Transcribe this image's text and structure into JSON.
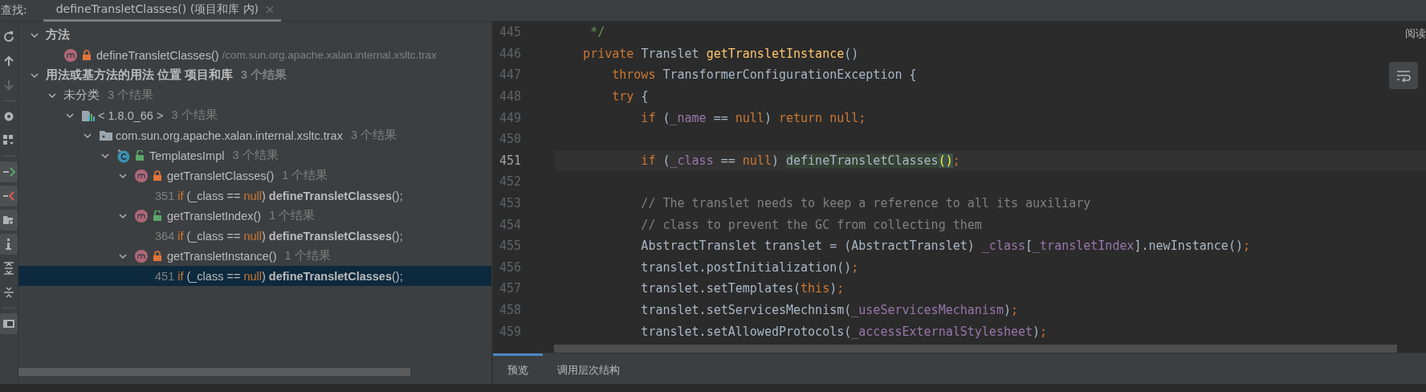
{
  "find_bar": {
    "label": "查找:",
    "tab": {
      "title": "defineTransletClasses() (项目和库 内)",
      "selected": true
    }
  },
  "toolbar": [
    {
      "kind": "refresh",
      "disabled": false,
      "on": false
    },
    {
      "kind": "up",
      "disabled": false,
      "on": false
    },
    {
      "kind": "down",
      "disabled": true,
      "on": false
    },
    {
      "kind": "settings",
      "disabled": false,
      "on": false
    },
    {
      "kind": "grid",
      "disabled": false,
      "on": false
    },
    {
      "kind": "import",
      "disabled": false,
      "on": true
    },
    {
      "kind": "export",
      "disabled": false,
      "on": true
    },
    {
      "kind": "folder-gear",
      "disabled": false,
      "on": true
    },
    {
      "kind": "info",
      "disabled": false,
      "on": true
    },
    {
      "kind": "expand",
      "disabled": false,
      "on": false
    },
    {
      "kind": "collapse",
      "disabled": false,
      "on": false
    },
    {
      "kind": "panel",
      "disabled": false,
      "on": true
    }
  ],
  "tree": [
    {
      "kind": "group",
      "label": "方法",
      "expanded": true,
      "selected": false,
      "children": [
        {
          "kind": "method",
          "label": "defineTransletClasses()",
          "locked": true,
          "path": "/com.sun.org.apache.xalan.internal.xsltc.trax",
          "selected": false
        }
      ]
    },
    {
      "kind": "group",
      "label": "用法或基方法的用法 位置 项目和库",
      "count": "3 个结果",
      "expanded": true,
      "selected": false,
      "children": [
        {
          "kind": "category",
          "label": "未分类",
          "count": "3 个结果",
          "expanded": true,
          "selected": false,
          "children": [
            {
              "kind": "library",
              "label": "< 1.8.0_66 >",
              "count": "3 个结果",
              "expanded": true,
              "selected": false,
              "children": [
                {
                  "kind": "package",
                  "label": "com.sun.org.apache.xalan.internal.xsltc.trax",
                  "count": "3 个结果",
                  "expanded": true,
                  "selected": false,
                  "children": [
                    {
                      "kind": "class",
                      "label": "TemplatesImpl",
                      "locked": false,
                      "count": "3 个结果",
                      "expanded": true,
                      "selected": false,
                      "children": [
                        {
                          "kind": "method",
                          "label": "getTransletClasses()",
                          "locked": true,
                          "count": "1 个结果",
                          "expanded": true,
                          "selected": false,
                          "children": [
                            {
                              "kind": "usage",
                              "line": "351",
                              "selected": false,
                              "tokens": [
                                {
                                  "kind": "keyword",
                                  "text": "if"
                                },
                                {
                                  "kind": "plain",
                                  "text": " (_class == "
                                },
                                {
                                  "kind": "keyword",
                                  "text": "null"
                                },
                                {
                                  "kind": "plain",
                                  "text": ")"
                                },
                                {
                                  "kind": "match",
                                  "text": " defineTransletClasses"
                                },
                                {
                                  "kind": "plain",
                                  "text": "();"
                                }
                              ]
                            }
                          ]
                        },
                        {
                          "kind": "method",
                          "label": "getTransletIndex()",
                          "locked": false,
                          "count": "1 个结果",
                          "expanded": true,
                          "selected": false,
                          "children": [
                            {
                              "kind": "usage",
                              "line": "364",
                              "selected": false,
                              "tokens": [
                                {
                                  "kind": "keyword",
                                  "text": "if"
                                },
                                {
                                  "kind": "plain",
                                  "text": " (_class == "
                                },
                                {
                                  "kind": "keyword",
                                  "text": "null"
                                },
                                {
                                  "kind": "plain",
                                  "text": ")"
                                },
                                {
                                  "kind": "match",
                                  "text": " defineTransletClasses"
                                },
                                {
                                  "kind": "plain",
                                  "text": "();"
                                }
                              ]
                            }
                          ]
                        },
                        {
                          "kind": "method",
                          "label": "getTransletInstance()",
                          "locked": true,
                          "count": "1 个结果",
                          "expanded": true,
                          "selected": false,
                          "children": [
                            {
                              "kind": "usage",
                              "line": "451",
                              "selected": true,
                              "tokens": [
                                {
                                  "kind": "keyword",
                                  "text": "if"
                                },
                                {
                                  "kind": "plain",
                                  "text": " (_class == "
                                },
                                {
                                  "kind": "keyword",
                                  "text": "null"
                                },
                                {
                                  "kind": "plain",
                                  "text": ")"
                                },
                                {
                                  "kind": "match",
                                  "text": " defineTransletClasses"
                                },
                                {
                                  "kind": "plain",
                                  "text": "();"
                                }
                              ]
                            }
                          ]
                        }
                      ]
                    }
                  ]
                }
              ]
            }
          ]
        }
      ]
    }
  ],
  "code": [
    {
      "number": "445",
      "current": false,
      "tokens": [
        {
          "kind": "doc",
          "text": "     */"
        }
      ]
    },
    {
      "number": "446",
      "current": false,
      "tokens": [
        {
          "kind": "keyword",
          "text": "    private "
        },
        {
          "kind": "plain",
          "text": "Translet "
        },
        {
          "kind": "decl",
          "text": "getTransletInstance"
        },
        {
          "kind": "plain",
          "text": "()"
        }
      ]
    },
    {
      "number": "447",
      "current": false,
      "tokens": [
        {
          "kind": "keyword",
          "text": "        throws "
        },
        {
          "kind": "plain",
          "text": "TransformerConfigurationException {"
        }
      ]
    },
    {
      "number": "448",
      "current": false,
      "tokens": [
        {
          "kind": "keyword",
          "text": "        try "
        },
        {
          "kind": "plain",
          "text": "{"
        }
      ]
    },
    {
      "number": "449",
      "current": false,
      "tokens": [
        {
          "kind": "keyword",
          "text": "            if "
        },
        {
          "kind": "plain",
          "text": "("
        },
        {
          "kind": "field",
          "text": "_name "
        },
        {
          "kind": "plain",
          "text": "== "
        },
        {
          "kind": "keyword",
          "text": "null"
        },
        {
          "kind": "plain",
          "text": ") "
        },
        {
          "kind": "keyword",
          "text": "return null;"
        }
      ]
    },
    {
      "number": "450",
      "current": false
    },
    {
      "number": "451",
      "current": true,
      "tokens": [
        {
          "kind": "keyword",
          "text": "            if "
        },
        {
          "kind": "plain",
          "text": "("
        },
        {
          "kind": "field",
          "text": "_class "
        },
        {
          "kind": "plain",
          "text": "== "
        },
        {
          "kind": "keyword",
          "text": "null"
        },
        {
          "kind": "plain",
          "text": ") "
        },
        {
          "kind": "usage",
          "text": "defineTransletClasses"
        },
        {
          "kind": "brace",
          "text": "()"
        },
        {
          "kind": "keyword",
          "text": ";"
        }
      ]
    },
    {
      "number": "452",
      "current": false
    },
    {
      "number": "453",
      "current": false,
      "tokens": [
        {
          "kind": "comment",
          "text": "            // The translet needs to keep a reference to all its auxiliary"
        }
      ]
    },
    {
      "number": "454",
      "current": false,
      "tokens": [
        {
          "kind": "comment",
          "text": "            // class to prevent the GC from collecting them"
        }
      ]
    },
    {
      "number": "455",
      "current": false,
      "tokens": [
        {
          "kind": "plain",
          "text": "            AbstractTranslet translet = (AbstractTranslet) "
        },
        {
          "kind": "field",
          "text": "_class"
        },
        {
          "kind": "plain",
          "text": "["
        },
        {
          "kind": "field",
          "text": "_transletIndex"
        },
        {
          "kind": "plain",
          "text": "].newInstance()"
        },
        {
          "kind": "keyword",
          "text": ";"
        }
      ]
    },
    {
      "number": "456",
      "current": false,
      "tokens": [
        {
          "kind": "plain",
          "text": "            translet.postInitialization()"
        },
        {
          "kind": "keyword",
          "text": ";"
        }
      ]
    },
    {
      "number": "457",
      "current": false,
      "tokens": [
        {
          "kind": "plain",
          "text": "            translet.setTemplates("
        },
        {
          "kind": "keyword",
          "text": "this"
        },
        {
          "kind": "plain",
          "text": ")"
        },
        {
          "kind": "keyword",
          "text": ";"
        }
      ]
    },
    {
      "number": "458",
      "current": false,
      "tokens": [
        {
          "kind": "plain",
          "text": "            translet.setServicesMechnism("
        },
        {
          "kind": "field",
          "text": "_useServicesMechanism"
        },
        {
          "kind": "plain",
          "text": ")"
        },
        {
          "kind": "keyword",
          "text": ";"
        }
      ]
    },
    {
      "number": "459",
      "current": false,
      "tokens": [
        {
          "kind": "plain",
          "text": "            translet.setAllowedProtocols("
        },
        {
          "kind": "field",
          "text": "_accessExternalStylesheet"
        },
        {
          "kind": "plain",
          "text": ")"
        },
        {
          "kind": "keyword",
          "text": ";"
        }
      ]
    }
  ],
  "reader_mode": {
    "label": "阅读"
  },
  "bottom_tabs": [
    {
      "label": "预览",
      "selected": true
    },
    {
      "label": "调用层次结构",
      "selected": false
    }
  ]
}
